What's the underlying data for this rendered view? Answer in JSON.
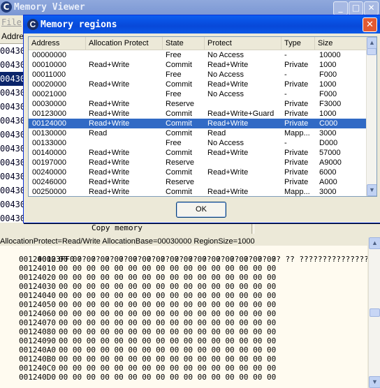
{
  "window": {
    "title": "Memory Viewer",
    "menu_file": "File"
  },
  "bg_list": {
    "header": "Addre",
    "rows": [
      "00430",
      "00430",
      "00430",
      "00430",
      "00430",
      "00430",
      "00430",
      "00430",
      "00430",
      "00430",
      "00430",
      "00430",
      "00430"
    ]
  },
  "copy_label": "Copy memory",
  "info_line": "AllocationProtect=Read/Write  AllocationBase=00030000 RegionSize=1000",
  "dialog": {
    "title": "Memory regions",
    "columns": [
      "Address",
      "Allocation Protect",
      "State",
      "Protect",
      "Type",
      "Size"
    ],
    "rows": [
      [
        "00000000",
        "",
        "Free",
        "No Access",
        "-",
        "10000"
      ],
      [
        "00010000",
        "Read+Write",
        "Commit",
        "Read+Write",
        "Private",
        "1000"
      ],
      [
        "00011000",
        "",
        "Free",
        "No Access",
        "-",
        "F000"
      ],
      [
        "00020000",
        "Read+Write",
        "Commit",
        "Read+Write",
        "Private",
        "1000"
      ],
      [
        "00021000",
        "",
        "Free",
        "No Access",
        "-",
        "F000"
      ],
      [
        "00030000",
        "Read+Write",
        "Reserve",
        "",
        "Private",
        "F3000"
      ],
      [
        "00123000",
        "Read+Write",
        "Commit",
        "Read+Write+Guard",
        "Private",
        "1000"
      ],
      [
        "00124000",
        "Read+Write",
        "Commit",
        "Read+Write",
        "Private",
        "C000"
      ],
      [
        "00130000",
        "Read",
        "Commit",
        "Read",
        "Mapp...",
        "3000"
      ],
      [
        "00133000",
        "",
        "Free",
        "No Access",
        "-",
        "D000"
      ],
      [
        "00140000",
        "Read+Write",
        "Commit",
        "Read+Write",
        "Private",
        "57000"
      ],
      [
        "00197000",
        "Read+Write",
        "Reserve",
        "",
        "Private",
        "A9000"
      ],
      [
        "00240000",
        "Read+Write",
        "Commit",
        "Read+Write",
        "Private",
        "6000"
      ],
      [
        "00246000",
        "Read+Write",
        "Reserve",
        "",
        "Private",
        "A000"
      ],
      [
        "00250000",
        "Read+Write",
        "Commit",
        "Read+Write",
        "Mapp...",
        "3000"
      ]
    ],
    "selected_row": 7,
    "ok_label": "OK"
  },
  "hex": {
    "first": {
      "addr": "00123FF0",
      "bytes": "?? ?? ?? ?? ?? ?? ?? ?? ?? ?? ?? ?? ?? ?? ?? ??",
      "ascii": "????????????????"
    },
    "rows": [
      {
        "addr": "00124000",
        "bytes": "00 00 00 00 00 00 00 00 00 00 00 00 00 00 00 00"
      },
      {
        "addr": "00124010",
        "bytes": "00 00 00 00 00 00 00 00 00 00 00 00 00 00 00 00"
      },
      {
        "addr": "00124020",
        "bytes": "00 00 00 00 00 00 00 00 00 00 00 00 00 00 00 00"
      },
      {
        "addr": "00124030",
        "bytes": "00 00 00 00 00 00 00 00 00 00 00 00 00 00 00 00"
      },
      {
        "addr": "00124040",
        "bytes": "00 00 00 00 00 00 00 00 00 00 00 00 00 00 00 00"
      },
      {
        "addr": "00124050",
        "bytes": "00 00 00 00 00 00 00 00 00 00 00 00 00 00 00 00"
      },
      {
        "addr": "00124060",
        "bytes": "00 00 00 00 00 00 00 00 00 00 00 00 00 00 00 00"
      },
      {
        "addr": "00124070",
        "bytes": "00 00 00 00 00 00 00 00 00 00 00 00 00 00 00 00"
      },
      {
        "addr": "00124080",
        "bytes": "00 00 00 00 00 00 00 00 00 00 00 00 00 00 00 00"
      },
      {
        "addr": "00124090",
        "bytes": "00 00 00 00 00 00 00 00 00 00 00 00 00 00 00 00"
      },
      {
        "addr": "001240A0",
        "bytes": "00 00 00 00 00 00 00 00 00 00 00 00 00 00 00 00"
      },
      {
        "addr": "001240B0",
        "bytes": "00 00 00 00 00 00 00 00 00 00 00 00 00 00 00 00"
      },
      {
        "addr": "001240C0",
        "bytes": "00 00 00 00 00 00 00 00 00 00 00 00 00 00 00 00"
      },
      {
        "addr": "001240D0",
        "bytes": "00 00 00 00 00 00 00 00 00 00 00 00 00 00 00 00"
      }
    ]
  },
  "colors": {
    "selection": "#316ac5",
    "dialog_title": "#0848d8",
    "close_button": "#e35a32"
  }
}
